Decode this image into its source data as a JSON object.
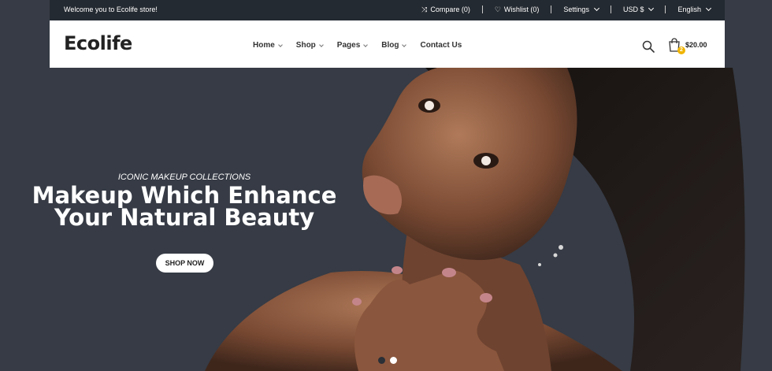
{
  "topbar": {
    "welcome": "Welcome you to Ecolife store!",
    "compare": "Compare (0)",
    "wishlist": "Wishlist (0)",
    "settings": "Settings",
    "currency": "USD $",
    "language": "English"
  },
  "header": {
    "logo": "Ecolife",
    "nav": {
      "home": "Home",
      "shop": "Shop",
      "pages": "Pages",
      "blog": "Blog",
      "contact": "Contact Us"
    },
    "cart_total": "$20.00",
    "cart_count": "2"
  },
  "hero": {
    "subtitle": "ICONIC MAKEUP COLLECTIONS",
    "title_line1": "Makeup Which Enhance",
    "title_line2": "Your Natural Beauty",
    "button": "SHOP NOW"
  },
  "slider": {
    "slides": 2,
    "active": 1
  },
  "colors": {
    "background": "#363b45",
    "topbar": "#242a31",
    "badge": "#f0b400"
  }
}
